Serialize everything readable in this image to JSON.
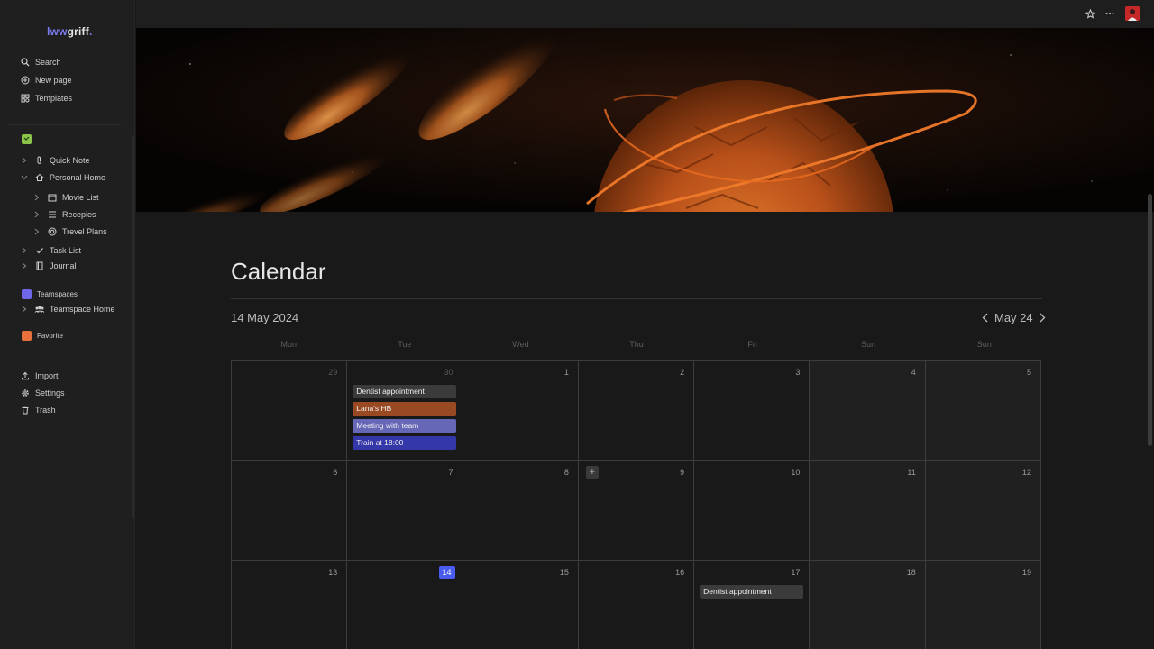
{
  "app": {
    "logo": {
      "mark": "lww",
      "text": "griff",
      "dot": "."
    }
  },
  "sidebar": {
    "actions": [
      {
        "label": "Search",
        "icon": "search-icon"
      },
      {
        "label": "New page",
        "icon": "plus-circle-icon"
      },
      {
        "label": "Templates",
        "icon": "templates-icon"
      }
    ],
    "workspace_icon_color": "#8bc34a",
    "pages": [
      {
        "label": "Quick Note",
        "icon": "paperclip-icon"
      },
      {
        "label": "Personal Home",
        "icon": "home-icon",
        "expanded": true
      },
      {
        "label": "Movie List",
        "icon": "calendar-icon"
      },
      {
        "label": "Recepies",
        "icon": "list-icon"
      },
      {
        "label": "Trevel Plans",
        "icon": "target-icon"
      },
      {
        "label": "Task List",
        "icon": "check-icon"
      },
      {
        "label": "Journal",
        "icon": "journal-icon"
      }
    ],
    "teamspaces": {
      "label": "Teamspaces",
      "color": "#6f66e8"
    },
    "teamspace_home": {
      "label": "Teamspace Home",
      "icon": "people-icon"
    },
    "favorite": {
      "label": "Favorite",
      "color": "#e8703a"
    },
    "footer": [
      {
        "label": "Import",
        "icon": "upload-icon"
      },
      {
        "label": "Settings",
        "icon": "gear-icon"
      },
      {
        "label": "Trash",
        "icon": "trash-icon"
      }
    ]
  },
  "topbar": {
    "icons": [
      "star-icon",
      "more-icon",
      "avatar"
    ],
    "avatar_color": "#c62828"
  },
  "page": {
    "title": "Calendar",
    "current_date": "14 May 2024",
    "month_label": "May 24"
  },
  "calendar": {
    "weekdays": [
      "Mon",
      "Tue",
      "Wed",
      "Thu",
      "Fri",
      "Sun",
      "Sun"
    ],
    "weeks": [
      [
        {
          "day": "29",
          "faded": true
        },
        {
          "day": "30",
          "faded": true,
          "events": [
            {
              "title": "Dentist appointment",
              "color": "#3b3b3b"
            },
            {
              "title": "Lana's HB",
              "color": "#9a4a22"
            },
            {
              "title": "Meeting with team",
              "color": "#6767b8"
            },
            {
              "title": "Train at 18:00",
              "color": "#3437a8"
            }
          ]
        },
        {
          "day": "1"
        },
        {
          "day": "2"
        },
        {
          "day": "3"
        },
        {
          "day": "4",
          "weekend": true
        },
        {
          "day": "5",
          "weekend": true
        }
      ],
      [
        {
          "day": "6"
        },
        {
          "day": "7"
        },
        {
          "day": "8"
        },
        {
          "day": "9",
          "add": true
        },
        {
          "day": "10"
        },
        {
          "day": "11",
          "weekend": true
        },
        {
          "day": "12",
          "weekend": true
        }
      ],
      [
        {
          "day": "13"
        },
        {
          "day": "14",
          "today": true
        },
        {
          "day": "15"
        },
        {
          "day": "16"
        },
        {
          "day": "17",
          "events": [
            {
              "title": "Dentist appointment",
              "color": "#3b3b3b"
            }
          ]
        },
        {
          "day": "18",
          "weekend": true
        },
        {
          "day": "19",
          "weekend": true
        }
      ]
    ]
  }
}
